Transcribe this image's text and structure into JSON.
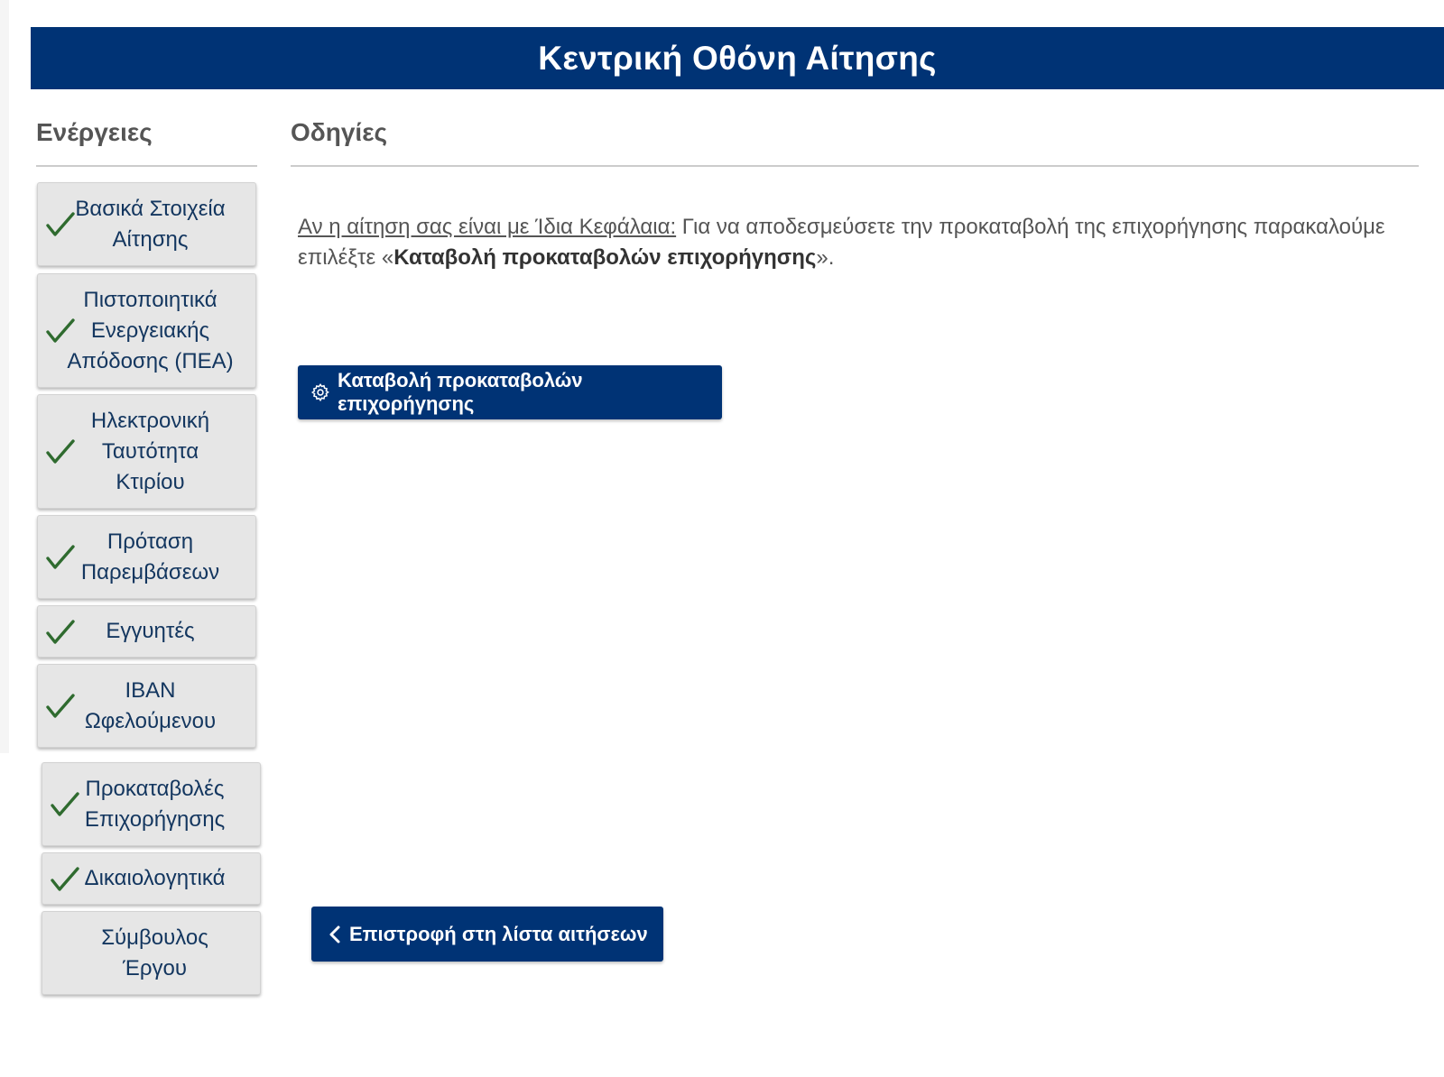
{
  "header": {
    "title": "Κεντρική Οθόνη Αίτησης"
  },
  "sidebar": {
    "title": "Ενέργειες",
    "items": [
      {
        "label_lines": [
          "Βασικά Στοιχεία",
          "Αίτησης"
        ],
        "completed": true
      },
      {
        "label_lines": [
          "Πιστοποιητικά",
          "Ενεργειακής",
          "Απόδοσης (ΠΕΑ)"
        ],
        "completed": true
      },
      {
        "label_lines": [
          "Ηλεκτρονική",
          "Ταυτότητα",
          "Κτιρίου"
        ],
        "completed": true
      },
      {
        "label_lines": [
          "Πρόταση",
          "Παρεμβάσεων"
        ],
        "completed": true
      },
      {
        "label_lines": [
          "Εγγυητές"
        ],
        "completed": true
      },
      {
        "label_lines": [
          "IBAN",
          "Ωφελούμενου"
        ],
        "completed": true
      },
      {
        "label_lines": [
          "Προκαταβολές",
          "Επιχορήγησης"
        ],
        "completed": true
      },
      {
        "label_lines": [
          "Δικαιολογητικά"
        ],
        "completed": true
      },
      {
        "label_lines": [
          "Σύμβουλος",
          "Έργου"
        ],
        "completed": false
      }
    ]
  },
  "main": {
    "title": "Οδηγίες",
    "instruction": {
      "underlined": "Αν η αίτηση σας είναι με Ίδια Κεφάλαια:",
      "text_before": " Για να αποδεσμεύσετε την προκαταβολή της επιχορήγησης παρακαλούμε επιλέξτε «",
      "bold": "Καταβολή προκαταβολών επιχορήγησης",
      "text_after": "»."
    },
    "grant_button_label": "Καταβολή προκαταβολών επιχορήγησης",
    "back_button_label": "Επιστροφή στη λίστα αιτήσεων"
  },
  "colors": {
    "primary": "#003375",
    "sidebar_button_bg": "#e6e6e6",
    "sidebar_text": "#13365f",
    "check": "#2f6b2f"
  },
  "icons": {
    "check": "check-icon",
    "gear": "gear-icon",
    "back": "chevron-left-icon"
  }
}
